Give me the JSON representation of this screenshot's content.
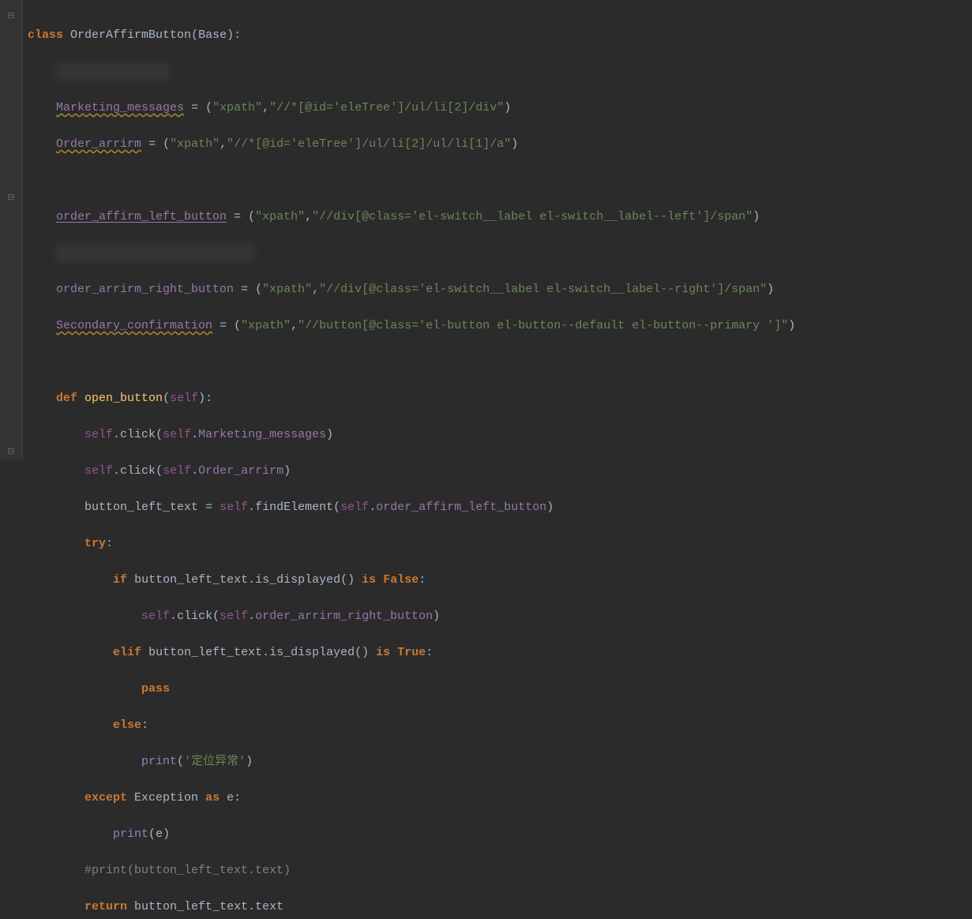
{
  "line1": {
    "kw_class": "class",
    "cls_name": "OrderAffirmButton",
    "base": "Base"
  },
  "blur1": "xxxxxxxxxxxxxxxx",
  "line3": {
    "attr": "Marketing_messages",
    "xp": "xpath",
    "q1": "\"",
    "val": "//*[@id='eleTree']/ul/li[2]/div"
  },
  "line4": {
    "attr": "Order_arrirm",
    "xp": "xpath",
    "val": "//*[@id='eleTree']/ul/li[2]/ul/li[1]/a"
  },
  "line6": {
    "attr": "order_affirm_left_button",
    "xp": "xpath",
    "val": "//div[@class='el-switch__label el-switch__label--left']/span"
  },
  "blur2": "xxxxxxxxxxxxxxxxxxxxxxxxxxxx",
  "line8": {
    "attr": "order_arrirm_right_button",
    "xp": "xpath",
    "val": "//div[@class='el-switch__label el-switch__label--right']/span"
  },
  "line9": {
    "attr": "Secondary_confirmation",
    "xp": "xpath",
    "val": "//button[@class='el-button el-button--default el-button--primary ']"
  },
  "line11": {
    "kw": "def",
    "fn": "open_button",
    "self": "self"
  },
  "line12": {
    "self": "self",
    "click": "click",
    "arg": "Marketing_messages"
  },
  "line13": {
    "self": "self",
    "click": "click",
    "arg": "Order_arrirm"
  },
  "line14": {
    "var": "button_left_text",
    "self": "self",
    "fe": "findElement",
    "arg": "order_affirm_left_button"
  },
  "line15": {
    "kw": "try"
  },
  "line16": {
    "kw_if": "if",
    "var": "button_left_text",
    "call": "is_displayed",
    "kw_is": "is",
    "val": "False"
  },
  "line17": {
    "self": "self",
    "click": "click",
    "arg": "order_arrirm_right_button"
  },
  "line18": {
    "kw": "elif",
    "var": "button_left_text",
    "call": "is_displayed",
    "kw_is": "is",
    "val": "True"
  },
  "line19": {
    "kw": "pass"
  },
  "line20": {
    "kw": "else"
  },
  "line21": {
    "fn": "print",
    "str": "'定位异常'"
  },
  "line22": {
    "kw": "except",
    "exc": "Exception",
    "kw_as": "as",
    "e": "e"
  },
  "line23": {
    "fn": "print",
    "arg": "e"
  },
  "line24": {
    "comment": "#print(button_left_text.text)"
  },
  "line25": {
    "kw": "return",
    "var": "button_left_text",
    "prop": "text"
  }
}
